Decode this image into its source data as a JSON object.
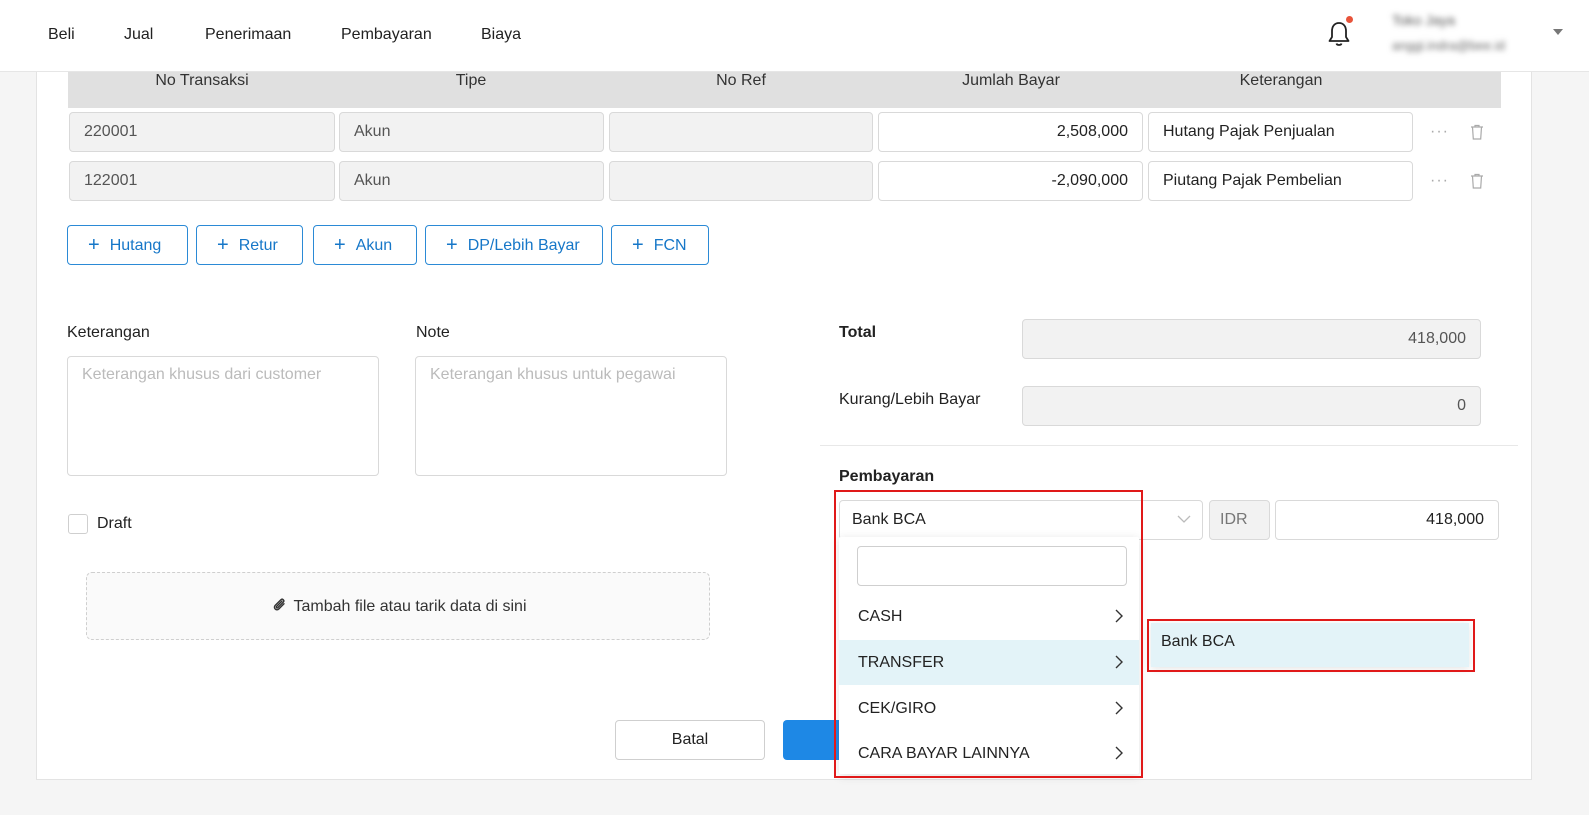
{
  "nav": {
    "items": [
      "Beli",
      "Jual",
      "Penerimaan",
      "Pembayaran",
      "Biaya"
    ],
    "user_name": "Toko Jaya",
    "user_email": "anggi.indra@bee.id"
  },
  "table": {
    "headers": [
      "No Transaksi",
      "Tipe",
      "No Ref",
      "Jumlah Bayar",
      "Keterangan"
    ],
    "rows": [
      {
        "no_transaksi": "220001",
        "tipe": "Akun",
        "no_ref": "",
        "jumlah_bayar": "2,508,000",
        "keterangan": "Hutang Pajak Penjualan",
        "more": "···"
      },
      {
        "no_transaksi": "122001",
        "tipe": "Akun",
        "no_ref": "",
        "jumlah_bayar": "-2,090,000",
        "keterangan": "Piutang Pajak Pembelian",
        "more": "···"
      }
    ]
  },
  "add_buttons": [
    "Hutang",
    "Retur",
    "Akun",
    "DP/Lebih Bayar",
    "FCN"
  ],
  "form": {
    "keterangan_label": "Keterangan",
    "keterangan_placeholder": "Keterangan khusus dari customer",
    "note_label": "Note",
    "note_placeholder": "Keterangan khusus untuk pegawai",
    "draft_label": "Draft",
    "upload_label": "Tambah file atau tarik data di sini"
  },
  "summary": {
    "total_label": "Total",
    "total_value": "418,000",
    "kurang_label": "Kurang/Lebih Bayar",
    "kurang_value": "0"
  },
  "payment": {
    "label": "Pembayaran",
    "method": "Bank BCA",
    "currency": "IDR",
    "amount": "418,000",
    "options": [
      "CASH",
      "TRANSFER",
      "CEK/GIRO",
      "CARA BAYAR LAINNYA"
    ],
    "active_option": "TRANSFER",
    "sub_options": [
      "Bank BCA"
    ]
  },
  "actions": {
    "cancel": "Batal"
  },
  "colors": {
    "primary": "#1e88e5",
    "highlight": "#e01919",
    "active_item": "#e3f3f8"
  }
}
